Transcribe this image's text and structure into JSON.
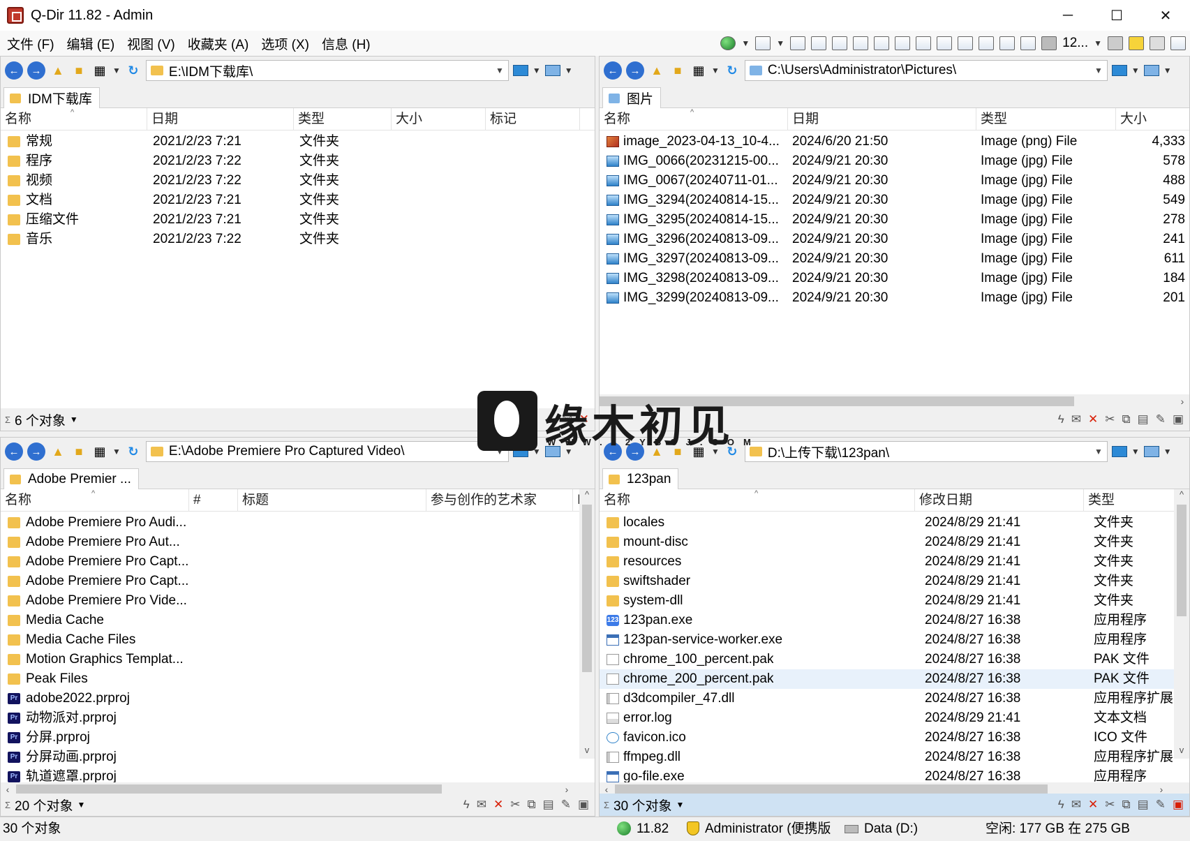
{
  "window": {
    "title": "Q-Dir 11.82 - Admin",
    "minimize": "─",
    "maximize": "☐",
    "close": "✕"
  },
  "menu": [
    "文件 (F)",
    "编辑 (E)",
    "视图 (V)",
    "收藏夹 (A)",
    "选项 (X)",
    "信息 (H)"
  ],
  "main_toolbar": {
    "zoom_label": "12..."
  },
  "pane_tl": {
    "path": "E:\\IDM下载库\\",
    "tab": "IDM下载库",
    "columns": [
      "名称",
      "日期",
      "类型",
      "大小",
      "标记"
    ],
    "rows": [
      [
        "常规",
        "2021/2/23 7:21",
        "文件夹"
      ],
      [
        "程序",
        "2021/2/23 7:22",
        "文件夹"
      ],
      [
        "视频",
        "2021/2/23 7:22",
        "文件夹"
      ],
      [
        "文档",
        "2021/2/23 7:21",
        "文件夹"
      ],
      [
        "压缩文件",
        "2021/2/23 7:21",
        "文件夹"
      ],
      [
        "音乐",
        "2021/2/23 7:22",
        "文件夹"
      ]
    ],
    "status": "6 个对象"
  },
  "pane_tr": {
    "path": "C:\\Users\\Administrator\\Pictures\\",
    "tab": "图片",
    "columns": [
      "名称",
      "日期",
      "类型",
      "大小"
    ],
    "rows": [
      [
        "image_2023-04-13_10-4...",
        "2024/6/20 21:50",
        "Image (png) File",
        "4,333"
      ],
      [
        "IMG_0066(20231215-00...",
        "2024/9/21 20:30",
        "Image (jpg) File",
        "578"
      ],
      [
        "IMG_0067(20240711-01...",
        "2024/9/21 20:30",
        "Image (jpg) File",
        "488"
      ],
      [
        "IMG_3294(20240814-15...",
        "2024/9/21 20:30",
        "Image (jpg) File",
        "549"
      ],
      [
        "IMG_3295(20240814-15...",
        "2024/9/21 20:30",
        "Image (jpg) File",
        "278"
      ],
      [
        "IMG_3296(20240813-09...",
        "2024/9/21 20:30",
        "Image (jpg) File",
        "241"
      ],
      [
        "IMG_3297(20240813-09...",
        "2024/9/21 20:30",
        "Image (jpg) File",
        "611"
      ],
      [
        "IMG_3298(20240813-09...",
        "2024/9/21 20:30",
        "Image (jpg) File",
        "184"
      ],
      [
        "IMG_3299(20240813-09...",
        "2024/9/21 20:30",
        "Image (jpg) File",
        "201"
      ]
    ]
  },
  "pane_bl": {
    "path": "E:\\Adobe Premiere Pro Captured Video\\",
    "tab": "Adobe Premier ...",
    "columns": [
      "名称",
      "#",
      "标题",
      "参与创作的艺术家",
      "I"
    ],
    "rows": [
      "Adobe Premiere Pro Audi...",
      "Adobe Premiere Pro Aut...",
      "Adobe Premiere Pro Capt...",
      "Adobe Premiere Pro Capt...",
      "Adobe Premiere Pro Vide...",
      "Media Cache",
      "Media Cache Files",
      "Motion Graphics Templat...",
      "Peak Files",
      "adobe2022.prproj",
      "动物派对.prproj",
      "分屏.prproj",
      "分屏动画.prproj",
      "轨道遮罩.prproj"
    ],
    "status": "20 个对象"
  },
  "pane_br": {
    "path": "D:\\上传下载\\123pan\\",
    "tab": "123pan",
    "columns": [
      "名称",
      "修改日期",
      "类型"
    ],
    "rows": [
      [
        "locales",
        "2024/8/29 21:41",
        "文件夹"
      ],
      [
        "mount-disc",
        "2024/8/29 21:41",
        "文件夹"
      ],
      [
        "resources",
        "2024/8/29 21:41",
        "文件夹"
      ],
      [
        "swiftshader",
        "2024/8/29 21:41",
        "文件夹"
      ],
      [
        "system-dll",
        "2024/8/29 21:41",
        "文件夹"
      ],
      [
        "123pan.exe",
        "2024/8/27 16:38",
        "应用程序"
      ],
      [
        "123pan-service-worker.exe",
        "2024/8/27 16:38",
        "应用程序"
      ],
      [
        "chrome_100_percent.pak",
        "2024/8/27 16:38",
        "PAK 文件"
      ],
      [
        "chrome_200_percent.pak",
        "2024/8/27 16:38",
        "PAK 文件"
      ],
      [
        "d3dcompiler_47.dll",
        "2024/8/27 16:38",
        "应用程序扩展"
      ],
      [
        "error.log",
        "2024/8/29 21:41",
        "文本文档"
      ],
      [
        "favicon.ico",
        "2024/8/27 16:38",
        "ICO 文件"
      ],
      [
        "ffmpeg.dll",
        "2024/8/27 16:38",
        "应用程序扩展"
      ],
      [
        "go-file.exe",
        "2024/8/27 16:38",
        "应用程序"
      ]
    ],
    "status": "30 个对象"
  },
  "bottom": {
    "objects": "30 个对象",
    "version": "11.82",
    "user": "Administrator (便携版",
    "drive": "Data (D:)",
    "space": "空闲: 177 GB 在 275 GB"
  },
  "watermark": {
    "text": "缘木初见",
    "url": "WWW.52YBCJ.COM"
  }
}
